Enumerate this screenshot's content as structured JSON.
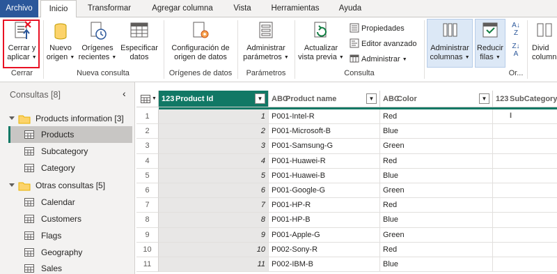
{
  "tabs": [
    "Archivo",
    "Inicio",
    "Transformar",
    "Agregar columna",
    "Vista",
    "Herramientas",
    "Ayuda"
  ],
  "ribbon": {
    "close_apply": {
      "line1": "Cerrar y",
      "line2": "aplicar"
    },
    "new_source": {
      "line1": "Nuevo",
      "line2": "origen"
    },
    "recent_sources": {
      "line1": "Orígenes",
      "line2": "recientes"
    },
    "enter_data": {
      "line1": "Especificar",
      "line2": "datos"
    },
    "data_source_settings": {
      "line1": "Configuración de",
      "line2": "origen de datos"
    },
    "manage_params": {
      "line1": "Administrar",
      "line2": "parámetros"
    },
    "refresh_preview": {
      "line1": "Actualizar",
      "line2": "vista previa"
    },
    "properties": "Propiedades",
    "advanced_editor": "Editor avanzado",
    "manage": "Administrar",
    "manage_columns": {
      "line1": "Administrar",
      "line2": "columnas"
    },
    "reduce_rows": {
      "line1": "Reducir",
      "line2": "filas"
    },
    "divide_column": {
      "line1": "Divid",
      "line2": "column"
    },
    "groups": {
      "close": "Cerrar",
      "new_query": "Nueva consulta",
      "data_sources": "Orígenes de datos",
      "parameters": "Parámetros",
      "query": "Consulta",
      "sort": "Or..."
    }
  },
  "sidebar": {
    "title": "Consultas [8]",
    "groups": [
      {
        "label": "Products information [3]",
        "items": [
          "Products",
          "Subcategory",
          "Category"
        ]
      },
      {
        "label": "Otras consultas [5]",
        "items": [
          "Calendar",
          "Customers",
          "Flags",
          "Geography",
          "Sales"
        ]
      }
    ]
  },
  "grid": {
    "columns": [
      {
        "type": "123",
        "name": "Product Id"
      },
      {
        "type": "ABC",
        "name": "Product name"
      },
      {
        "type": "ABC",
        "name": "Color"
      },
      {
        "type": "123",
        "name": "SubCategory I"
      }
    ],
    "rows": [
      {
        "n": "1",
        "id": "1",
        "name": "P001-Intel-R",
        "color": "Red"
      },
      {
        "n": "2",
        "id": "2",
        "name": "P001-Microsoft-B",
        "color": "Blue"
      },
      {
        "n": "3",
        "id": "3",
        "name": "P001-Samsung-G",
        "color": "Green"
      },
      {
        "n": "4",
        "id": "4",
        "name": "P001-Huawei-R",
        "color": "Red"
      },
      {
        "n": "5",
        "id": "5",
        "name": "P001-Huawei-B",
        "color": "Blue"
      },
      {
        "n": "6",
        "id": "6",
        "name": "P001-Google-G",
        "color": "Green"
      },
      {
        "n": "7",
        "id": "7",
        "name": "P001-HP-R",
        "color": "Red"
      },
      {
        "n": "8",
        "id": "8",
        "name": "P001-HP-B",
        "color": "Blue"
      },
      {
        "n": "9",
        "id": "9",
        "name": "P001-Apple-G",
        "color": "Green"
      },
      {
        "n": "10",
        "id": "10",
        "name": "P002-Sony-R",
        "color": "Red"
      },
      {
        "n": "11",
        "id": "11",
        "name": "P002-IBM-B",
        "color": "Blue"
      }
    ]
  },
  "colors": {
    "accent": "#117865",
    "file_tab": "#2b579a",
    "highlight_border": "#e81123"
  }
}
